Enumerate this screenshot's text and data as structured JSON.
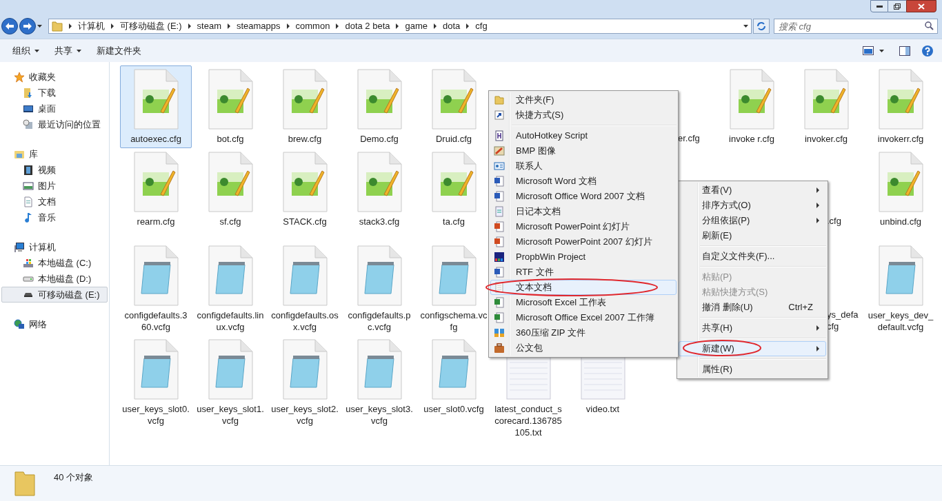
{
  "address_bar": {
    "crumbs": [
      "计算机",
      "可移动磁盘 (E:)",
      "steam",
      "steamapps",
      "common",
      "dota 2 beta",
      "game",
      "dota",
      "cfg"
    ]
  },
  "search": {
    "placeholder": "搜索 cfg"
  },
  "toolbar": {
    "buttons": [
      {
        "label": "组织",
        "dropdown": true
      },
      {
        "label": "共享",
        "dropdown": true
      },
      {
        "label": "新建文件夹",
        "dropdown": false
      }
    ]
  },
  "sidebar": {
    "groups": [
      {
        "label": "收藏夹",
        "kind": "favorites",
        "children": [
          {
            "label": "下载",
            "kind": "downloads",
            "selected": false
          },
          {
            "label": "桌面",
            "kind": "desktop",
            "selected": false
          },
          {
            "label": "最近访问的位置",
            "kind": "recent",
            "selected": false
          }
        ]
      },
      {
        "label": "库",
        "kind": "library",
        "children": [
          {
            "label": "视频",
            "kind": "video",
            "selected": false
          },
          {
            "label": "图片",
            "kind": "pictures",
            "selected": false
          },
          {
            "label": "文档",
            "kind": "documents",
            "selected": false
          },
          {
            "label": "音乐",
            "kind": "music",
            "selected": false
          }
        ]
      },
      {
        "label": "计算机",
        "kind": "computer",
        "children": [
          {
            "label": "本地磁盘 (C:)",
            "kind": "system-drive",
            "selected": false
          },
          {
            "label": "本地磁盘 (D:)",
            "kind": "drive",
            "selected": false
          },
          {
            "label": "可移动磁盘 (E:)",
            "kind": "removable",
            "selected": true
          }
        ]
      },
      {
        "label": "网络",
        "kind": "network"
      }
    ]
  },
  "files": [
    {
      "label": "autoexec.cfg",
      "kind": "cfg",
      "selected": true
    },
    {
      "label": "bot.cfg",
      "kind": "cfg",
      "selected": false
    },
    {
      "label": "brew.cfg",
      "kind": "cfg",
      "selected": false
    },
    {
      "label": "Demo.cfg",
      "kind": "cfg",
      "selected": false
    },
    {
      "label": "Druid.cfg",
      "kind": "cfg",
      "selected": false
    },
    {
      "kind": "hidden"
    },
    {
      "kind": "hidden"
    },
    {
      "lines": [
        "er.cfg"
      ],
      "kind": "cut",
      "selected": false
    },
    {
      "label": "invoke r.cfg",
      "kind": "cfg",
      "selected": false
    },
    {
      "label": "invoker.cfg",
      "kind": "cfg",
      "selected": false
    },
    {
      "label": "invokerr.cfg",
      "kind": "cfg",
      "selected": false
    },
    {
      "label": "rearm.cfg",
      "kind": "cfg",
      "selected": false
    },
    {
      "label": "sf.cfg",
      "kind": "cfg",
      "selected": false
    },
    {
      "label": "STACK.cfg",
      "kind": "cfg",
      "selected": false
    },
    {
      "label": "stack3.cfg",
      "kind": "cfg",
      "selected": false
    },
    {
      "label": "ta.cfg",
      "kind": "cfg",
      "selected": false
    },
    {
      "kind": "hidden"
    },
    {
      "kind": "hidden"
    },
    {
      "kind": "hidden"
    },
    {
      "kind": "hidden"
    },
    {
      "lines": [
        ".cfg"
      ],
      "kind": "cut",
      "selected": false
    },
    {
      "label": "unbind.cfg",
      "kind": "cfg",
      "selected": false
    },
    {
      "label": "configdefaults.360.vcfg",
      "kind": "vcfg",
      "selected": false
    },
    {
      "label": "configdefaults.linux.vcfg",
      "kind": "vcfg",
      "selected": false
    },
    {
      "label": "configdefaults.osx.vcfg",
      "kind": "vcfg",
      "selected": false
    },
    {
      "label": "configdefaults.pc.vcfg",
      "kind": "vcfg",
      "selected": false
    },
    {
      "label": "configschema.vcfg",
      "kind": "vcfg",
      "selected": false
    },
    {
      "kind": "hidden"
    },
    {
      "kind": "hidden"
    },
    {
      "kind": "hidden"
    },
    {
      "kind": "hidden"
    },
    {
      "lines": [
        "ys_defa",
        "cfg"
      ],
      "kind": "cut",
      "selected": false
    },
    {
      "label": "user_keys_dev_default.vcfg",
      "kind": "vcfg",
      "selected": false
    },
    {
      "label": "user_keys_slot0.vcfg",
      "kind": "vcfg",
      "selected": false
    },
    {
      "label": "user_keys_slot1.vcfg",
      "kind": "vcfg",
      "selected": false
    },
    {
      "label": "user_keys_slot2.vcfg",
      "kind": "vcfg",
      "selected": false
    },
    {
      "label": "user_keys_slot3.vcfg",
      "kind": "vcfg",
      "selected": false
    },
    {
      "label": "user_slot0.vcfg",
      "kind": "vcfg",
      "selected": false
    },
    {
      "label": "latest_conduct_scorecard.136785105.txt",
      "kind": "txt",
      "selected": false
    },
    {
      "label": "video.txt",
      "kind": "txt",
      "selected": false
    }
  ],
  "context_menu": {
    "groups": [
      [
        {
          "label": "查看(V)",
          "submenu": true,
          "disabled": false,
          "selected": false
        },
        {
          "label": "排序方式(O)",
          "submenu": true,
          "disabled": false,
          "selected": false
        },
        {
          "label": "分组依据(P)",
          "submenu": true,
          "disabled": false,
          "selected": false
        },
        {
          "label": "刷新(E)",
          "submenu": false,
          "disabled": false,
          "selected": false
        }
      ],
      [
        {
          "label": "自定义文件夹(F)...",
          "submenu": false,
          "disabled": false,
          "selected": false
        }
      ],
      [
        {
          "label": "粘贴(P)",
          "submenu": false,
          "disabled": true,
          "selected": false
        },
        {
          "label": "粘贴快捷方式(S)",
          "submenu": false,
          "disabled": true,
          "selected": false
        },
        {
          "label": "撤消 删除(U)",
          "shortcut": "Ctrl+Z",
          "submenu": false,
          "disabled": false,
          "selected": false
        }
      ],
      [
        {
          "label": "共享(H)",
          "submenu": true,
          "disabled": false,
          "selected": false
        }
      ],
      [
        {
          "label": "新建(W)",
          "submenu": true,
          "disabled": false,
          "selected": true
        }
      ],
      [
        {
          "label": "属性(R)",
          "submenu": false,
          "disabled": false,
          "selected": false
        }
      ]
    ]
  },
  "new_submenu": {
    "groups": [
      [
        {
          "label": "文件夹(F)",
          "kind": "folder",
          "selected": false
        },
        {
          "label": "快捷方式(S)",
          "kind": "shortcut",
          "selected": false
        }
      ],
      [
        {
          "label": "AutoHotkey Script",
          "kind": "script",
          "selected": false
        },
        {
          "label": "BMP 图像",
          "kind": "image",
          "selected": false
        },
        {
          "label": "联系人",
          "kind": "contact",
          "selected": false
        },
        {
          "label": "Microsoft Word 文档",
          "kind": "word",
          "selected": false
        },
        {
          "label": "Microsoft Office Word 2007 文档",
          "kind": "word",
          "selected": false
        },
        {
          "label": "日记本文档",
          "kind": "journal",
          "selected": false
        },
        {
          "label": "Microsoft PowerPoint 幻灯片",
          "kind": "slides",
          "selected": false
        },
        {
          "label": "Microsoft PowerPoint 2007 幻灯片",
          "kind": "slides",
          "selected": false
        },
        {
          "label": "PropbWin Project",
          "kind": "project",
          "selected": false
        },
        {
          "label": "RTF 文件",
          "kind": "word",
          "selected": false
        },
        {
          "label": "文本文档",
          "kind": "text",
          "selected": true
        },
        {
          "label": "Microsoft Excel 工作表",
          "kind": "sheet",
          "selected": false
        },
        {
          "label": "Microsoft Office Excel 2007 工作簿",
          "kind": "sheet",
          "selected": false
        },
        {
          "label": "360压缩 ZIP 文件",
          "kind": "archive",
          "selected": false
        },
        {
          "label": "公文包",
          "kind": "briefcase",
          "selected": false
        }
      ]
    ]
  },
  "status_bar": {
    "count": "40 个对象"
  }
}
